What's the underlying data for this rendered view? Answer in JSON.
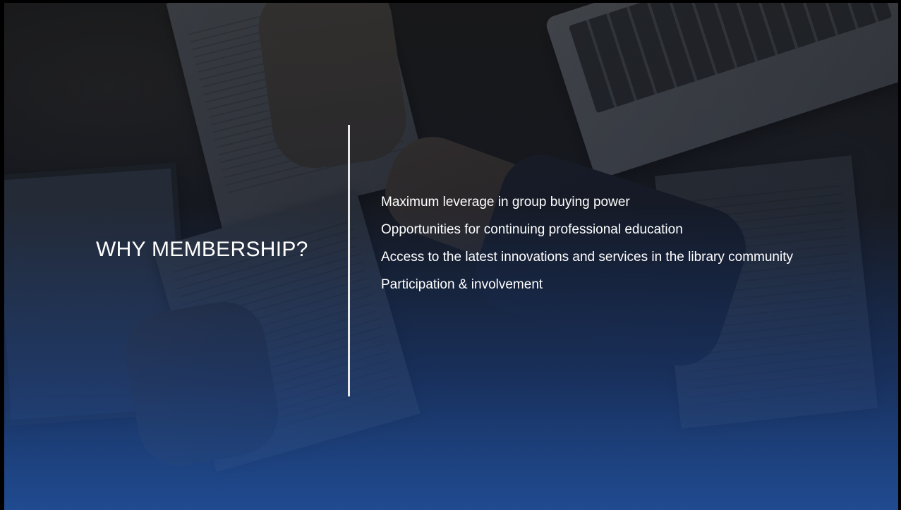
{
  "slide": {
    "title": "WHY MEMBERSHIP?",
    "bullets": [
      "Maximum leverage in group buying power",
      "Opportunities for continuing professional education",
      "Access to the latest innovations and services in the library community",
      "Participation & involvement"
    ]
  },
  "colors": {
    "text": "#ffffff",
    "divider": "#e8e8e8",
    "gradient_bottom": "#204c92"
  }
}
